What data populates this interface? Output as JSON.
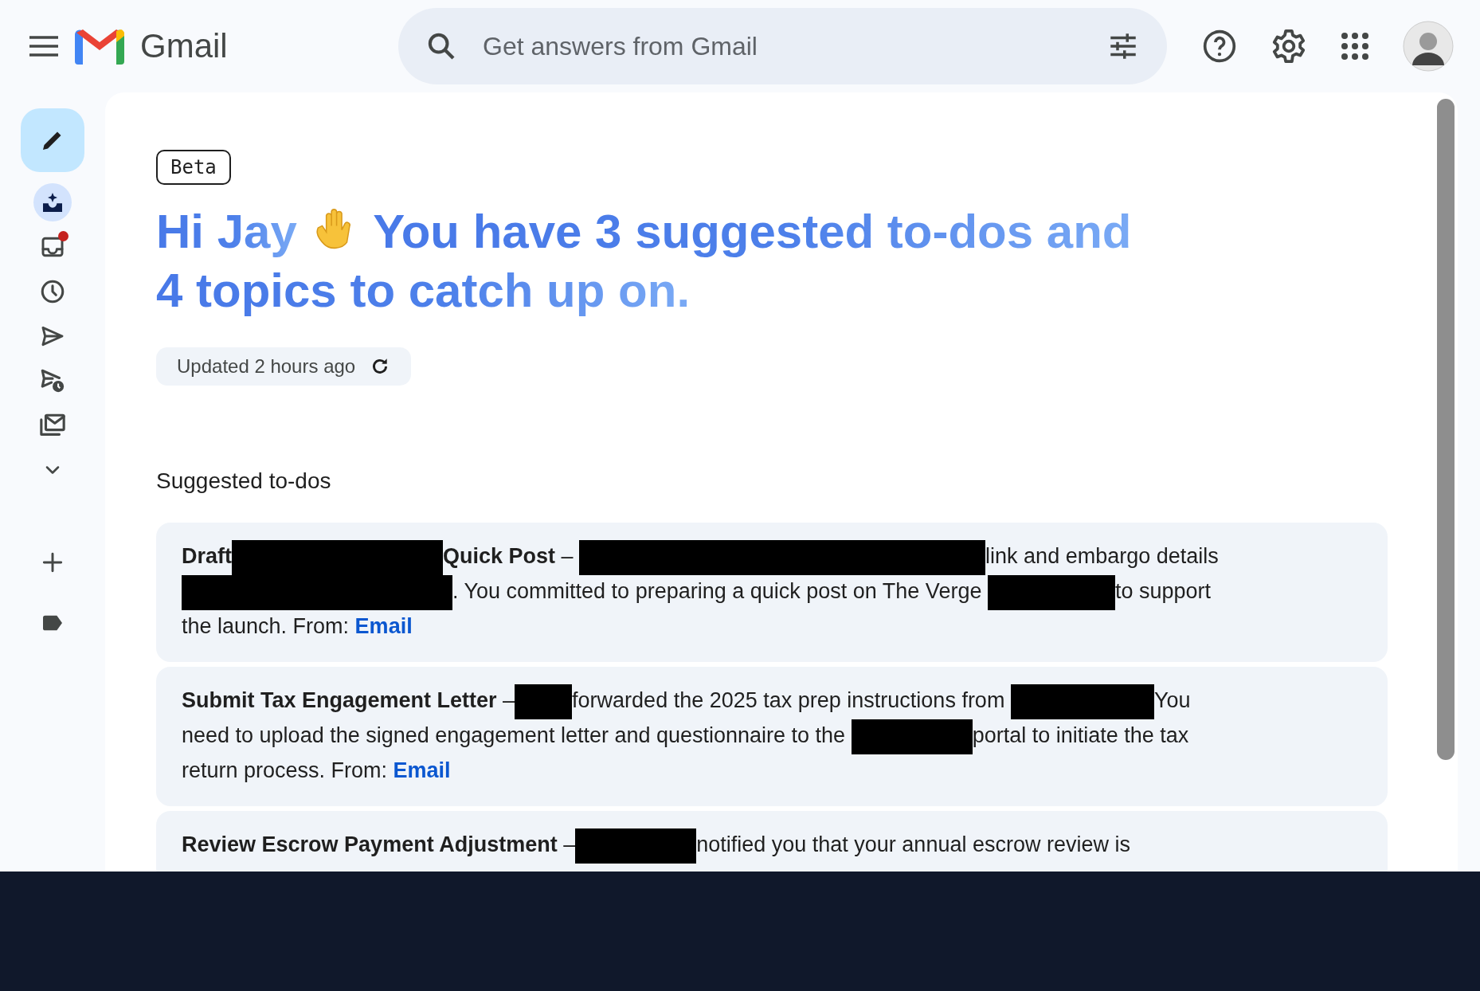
{
  "app": {
    "name": "Gmail"
  },
  "search": {
    "placeholder": "Get answers from Gmail"
  },
  "nav": [
    {
      "kind": "compose"
    },
    {
      "kind": "sparkle-inbox",
      "selected": true
    },
    {
      "kind": "inbox",
      "selected": false,
      "badge": true
    },
    {
      "kind": "clock",
      "selected": false
    },
    {
      "kind": "send",
      "selected": false
    },
    {
      "kind": "scheduled",
      "selected": false
    },
    {
      "kind": "all-mail",
      "selected": false
    },
    {
      "kind": "more",
      "selected": false
    },
    {
      "kind": "add",
      "selected": false
    },
    {
      "kind": "label",
      "selected": false
    }
  ],
  "badge": "Beta",
  "greeting": {
    "name": "Hi Jay",
    "message_lines": [
      "You have 3 suggested to-dos and",
      "4 topics to catch up on."
    ]
  },
  "updated": "Updated 2 hours ago",
  "section_title": "Suggested to-dos",
  "todos": [
    {
      "parts": [
        {
          "kind": "bold",
          "text": "Draft"
        },
        {
          "kind": "redacted"
        },
        {
          "kind": "bold",
          "text": "Quick Post"
        },
        {
          "kind": "text",
          "text": " – "
        },
        {
          "kind": "redacted"
        },
        {
          "kind": "text",
          "text": "link and embargo details "
        },
        {
          "kind": "redacted"
        },
        {
          "kind": "text",
          "text": ". You committed to preparing a quick post on The Verge "
        },
        {
          "kind": "redacted"
        },
        {
          "kind": "text",
          "text": "to support the launch. From: "
        },
        {
          "kind": "link",
          "text": "Email"
        }
      ]
    },
    {
      "parts": [
        {
          "kind": "bold",
          "text": "Submit Tax Engagement Letter"
        },
        {
          "kind": "text",
          "text": " –"
        },
        {
          "kind": "redacted"
        },
        {
          "kind": "text",
          "text": "forwarded the 2025 tax prep instructions from "
        },
        {
          "kind": "redacted"
        },
        {
          "kind": "text",
          "text": "You need to upload the signed engagement letter and questionnaire to the "
        },
        {
          "kind": "redacted"
        },
        {
          "kind": "text",
          "text": "portal to initiate the tax return process. From: "
        },
        {
          "kind": "link",
          "text": "Email"
        }
      ]
    },
    {
      "parts": [
        {
          "kind": "bold",
          "text": "Review Escrow Payment Adjustment"
        },
        {
          "kind": "text",
          "text": " –"
        },
        {
          "kind": "redacted"
        },
        {
          "kind": "text",
          "text": "notified you that your annual escrow review is"
        }
      ]
    }
  ]
}
